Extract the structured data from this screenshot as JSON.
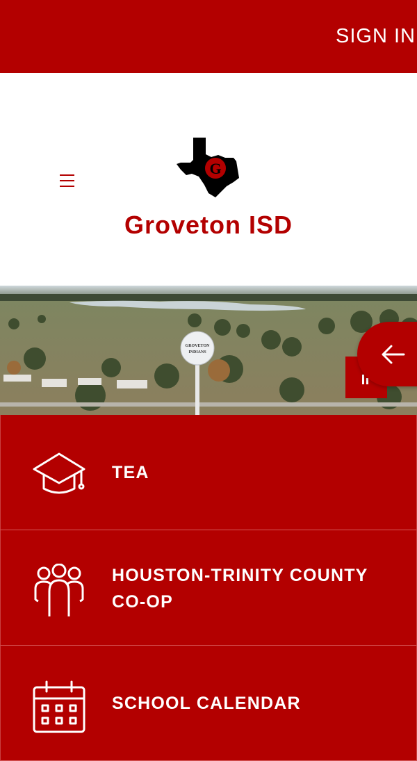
{
  "topbar": {
    "signin_label": "SIGN IN"
  },
  "header": {
    "site_title": "Groveton ISD",
    "logo_letter": "G"
  },
  "hero": {
    "tower_text_line1": "GROVETON",
    "tower_text_line2": "INDIANS"
  },
  "quicklinks": [
    {
      "label": "TEA",
      "icon": "graduation-cap-icon"
    },
    {
      "label": "HOUSTON-TRINITY COUNTY CO-OP",
      "label_line1": "HOUSTON-TRINITY COUNTY",
      "label_line2": "CO-OP",
      "icon": "people-group-icon"
    },
    {
      "label": "SCHOOL CALENDAR",
      "icon": "calendar-icon"
    }
  ],
  "colors": {
    "brand_red": "#b30000",
    "white": "#ffffff"
  }
}
